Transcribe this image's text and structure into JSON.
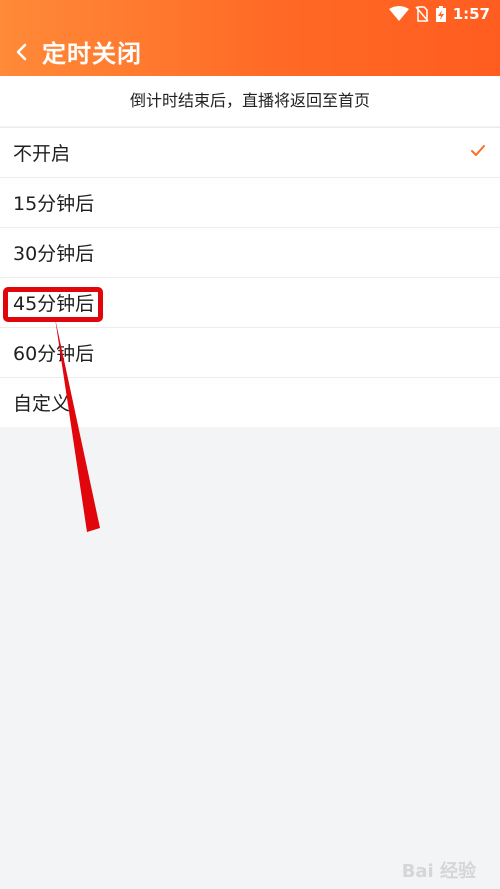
{
  "status_bar": {
    "time": "1:57",
    "icons": [
      "wifi-icon",
      "no-sim-icon",
      "battery-charging-icon"
    ]
  },
  "header": {
    "title": "定时关闭",
    "back_icon": "chevron-left-icon"
  },
  "notice": "倒计时结束后，直播将返回至首页",
  "options": [
    {
      "label": "不开启",
      "selected": true
    },
    {
      "label": "15分钟后",
      "selected": false
    },
    {
      "label": "30分钟后",
      "selected": false
    },
    {
      "label": "45分钟后",
      "selected": false
    },
    {
      "label": "60分钟后",
      "selected": false
    },
    {
      "label": "自定义",
      "selected": false
    }
  ],
  "annotation": {
    "highlighted_option": "45分钟后",
    "color": "#e0060b"
  },
  "colors": {
    "header_start": "#ff8a38",
    "header_end": "#ff5d20",
    "accent": "#ff6a25",
    "background": "#f2f4f5"
  }
}
